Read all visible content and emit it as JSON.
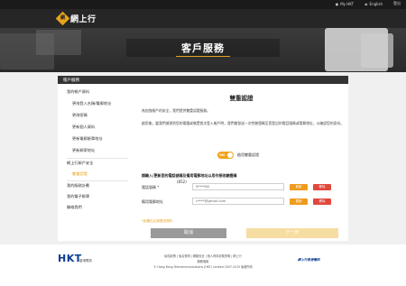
{
  "topbar": {
    "my_hkt": "My HKT",
    "english": "English",
    "logout": "登出"
  },
  "brand": {
    "logo_mark": "網",
    "logo_text": "網上行"
  },
  "hero": {
    "title": "客戶服務"
  },
  "card": {
    "header": "帳戶服務",
    "sidebar": [
      {
        "label": "我的帳戶資料",
        "level": 0
      },
      {
        "label": "更改登入名稱/電郵地址",
        "level": 1
      },
      {
        "label": "更改密碼",
        "level": 1
      },
      {
        "label": "更新個人資料",
        "level": 1
      },
      {
        "label": "更新電郵賬單地址",
        "level": 1
      },
      {
        "label": "更新郵寄地址",
        "level": 1
      },
      {
        "label": "網上行賬戶安全",
        "level": 0
      },
      {
        "label": "雙重認證",
        "level": 1
      },
      {
        "label": "我的服務計劃",
        "level": 0
      },
      {
        "label": "我的電子賬單",
        "level": 0
      },
      {
        "label": "聯絡我們",
        "level": 0
      }
    ]
  },
  "main": {
    "title": "雙重認證",
    "para1": "為加強帳戶的安全，我們提供雙重認證服務。",
    "para2": "啟用後，當我們偵測到您的電腦或裝置首次登入帳戶時，我們會發送一次性驗證碼至您登記的電話號碼或電郵地址，以確認您的身份。",
    "toggle_on": "ON",
    "toggle_label": "啟用雙重認證",
    "section_title": "請輸入/更新您的電話號碼及備用電郵地址以用作接收驗證碼",
    "phone_label": "電話號碼 *",
    "phone_prefix": "(852)",
    "phone_value": "9****08",
    "email_label": "備用電郵地址",
    "email_value": "c****@gmail.com",
    "edit_label": "更新",
    "delete_label": "移除",
    "note": "*此欄位必須提供資料",
    "cancel_label": "取消",
    "next_label": "下一步"
  },
  "footer": {
    "hkt": "HKT",
    "hkt_sub": "香港電訊",
    "links_line1": "私隱政策 | 免責聲明 | 網絡安全 | 個人資料收集聲明 | 網上行",
    "links_line2": "服務條款",
    "copyright": "© Hong Kong Telecommunications (HKT) Limited 2007-2015 版權所有",
    "right_text": "網上行香港電訊"
  }
}
